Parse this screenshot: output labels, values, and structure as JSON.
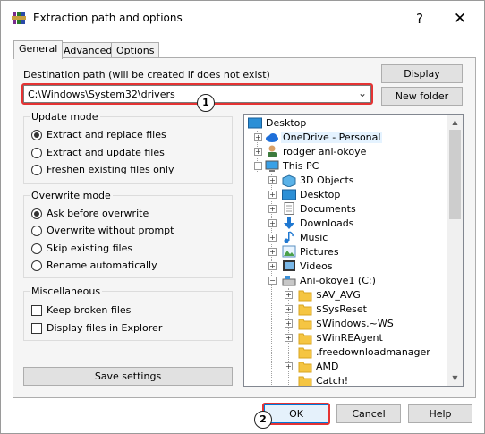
{
  "window": {
    "title": "Extraction path and options",
    "help_glyph": "?",
    "close_glyph": "✕"
  },
  "tabs": [
    {
      "label": "General",
      "active": true
    },
    {
      "label": "Advanced",
      "active": false
    },
    {
      "label": "Options",
      "active": false
    }
  ],
  "destination": {
    "label": "Destination path (will be created if does not exist)",
    "value": "C:\\Windows\\System32\\drivers",
    "dropdown_glyph": "⌄"
  },
  "side_buttons": {
    "display": "Display",
    "new_folder": "New folder"
  },
  "update_mode": {
    "title": "Update mode",
    "options": [
      {
        "label": "Extract and replace files",
        "checked": true
      },
      {
        "label": "Extract and update files",
        "checked": false
      },
      {
        "label": "Freshen existing files only",
        "checked": false
      }
    ]
  },
  "overwrite_mode": {
    "title": "Overwrite mode",
    "options": [
      {
        "label": "Ask before overwrite",
        "checked": true
      },
      {
        "label": "Overwrite without prompt",
        "checked": false
      },
      {
        "label": "Skip existing files",
        "checked": false
      },
      {
        "label": "Rename automatically",
        "checked": false
      }
    ]
  },
  "miscellaneous": {
    "title": "Miscellaneous",
    "options": [
      {
        "label": "Keep broken files",
        "checked": false
      },
      {
        "label": "Display files in Explorer",
        "checked": false
      }
    ]
  },
  "save_settings": "Save settings",
  "tree": {
    "items": [
      {
        "label": "Desktop",
        "icon": "desktop-icon"
      },
      {
        "label": "OneDrive - Personal",
        "icon": "onedrive-cloud-icon"
      },
      {
        "label": "rodger ani-okoye",
        "icon": "user-icon"
      },
      {
        "label": "This PC",
        "icon": "computer-icon"
      },
      {
        "label": "3D Objects",
        "icon": "3d-objects-icon"
      },
      {
        "label": "Desktop",
        "icon": "desktop-icon"
      },
      {
        "label": "Documents",
        "icon": "documents-icon"
      },
      {
        "label": "Downloads",
        "icon": "downloads-icon"
      },
      {
        "label": "Music",
        "icon": "music-icon"
      },
      {
        "label": "Pictures",
        "icon": "pictures-icon"
      },
      {
        "label": "Videos",
        "icon": "videos-icon"
      },
      {
        "label": "Ani-okoye1 (C:)",
        "icon": "drive-icon"
      },
      {
        "label": "$AV_AVG",
        "icon": "folder-icon"
      },
      {
        "label": "$SysReset",
        "icon": "folder-icon"
      },
      {
        "label": "$Windows.~WS",
        "icon": "folder-icon"
      },
      {
        "label": "$WinREAgent",
        "icon": "folder-icon"
      },
      {
        "label": ".freedownloadmanager",
        "icon": "folder-icon"
      },
      {
        "label": "AMD",
        "icon": "folder-icon"
      },
      {
        "label": "Catch!",
        "icon": "folder-icon"
      }
    ]
  },
  "footer": {
    "ok": "OK",
    "cancel": "Cancel",
    "help": "Help"
  },
  "annotations": {
    "badge_1": "1",
    "badge_2": "2"
  },
  "colors": {
    "highlight_red": "#e53333",
    "folder_yellow": "#f5c542",
    "panel_bg": "#f5f5f5"
  }
}
